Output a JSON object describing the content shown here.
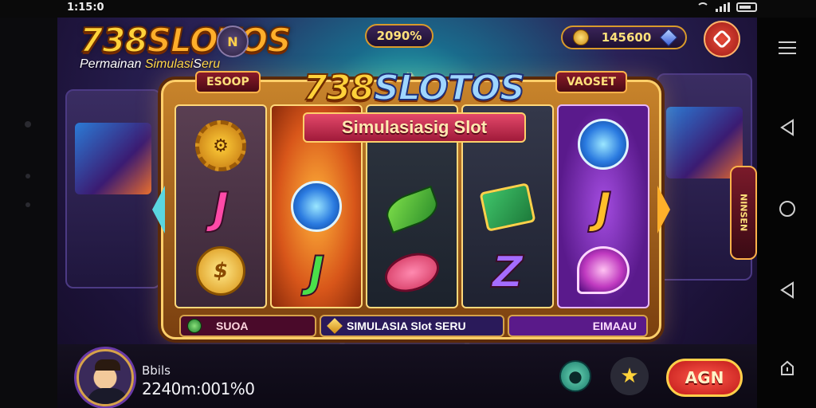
{
  "status_bar": {
    "time": "1:15:0"
  },
  "header": {
    "logo_text_a": "738",
    "logo_text_b": "SLOTOS",
    "tagline_a": "Permainan",
    "tagline_b": "Simulasi",
    "tagline_c": "S",
    "tagline_d": "eru",
    "hud_button_label": "N",
    "percent_pill": "2090%",
    "coin_balance": "145600"
  },
  "machine": {
    "title_a": "738",
    "title_b": "SLOTOS",
    "ribbon": "Simulasiasig Slot",
    "tag_left": "ESOOP",
    "tag_right": "VAOSET",
    "side_tab": "NINSEN",
    "reels": [
      {
        "symbols": [
          "gear",
          "J",
          "coin"
        ]
      },
      {
        "symbols": [
          "swirl",
          "J",
          "leaf-empty"
        ]
      },
      {
        "symbols": [
          "leaf",
          "disc",
          ""
        ]
      },
      {
        "symbols": [
          "card",
          "Z",
          ""
        ]
      },
      {
        "symbols": [
          "swirl",
          "J",
          "swirl2"
        ]
      }
    ],
    "bar_left": "SUOA",
    "bar_mid": "SIMULASIA Slot SERU",
    "bar_right": "EIMAAU"
  },
  "footer": {
    "user_name": "Bbils",
    "user_balance": "2240m:001%0",
    "spin_label": "AGN"
  },
  "colors": {
    "accent_gold": "#ffd23a",
    "spin_red": "#c01a1a",
    "purple": "#5a1a8a"
  },
  "icons": {
    "hud": "crown-icon",
    "coin": "coin-icon",
    "gem": "gem-icon",
    "menu": "settings-icon",
    "teal": "bell-icon",
    "star": "star-icon"
  }
}
